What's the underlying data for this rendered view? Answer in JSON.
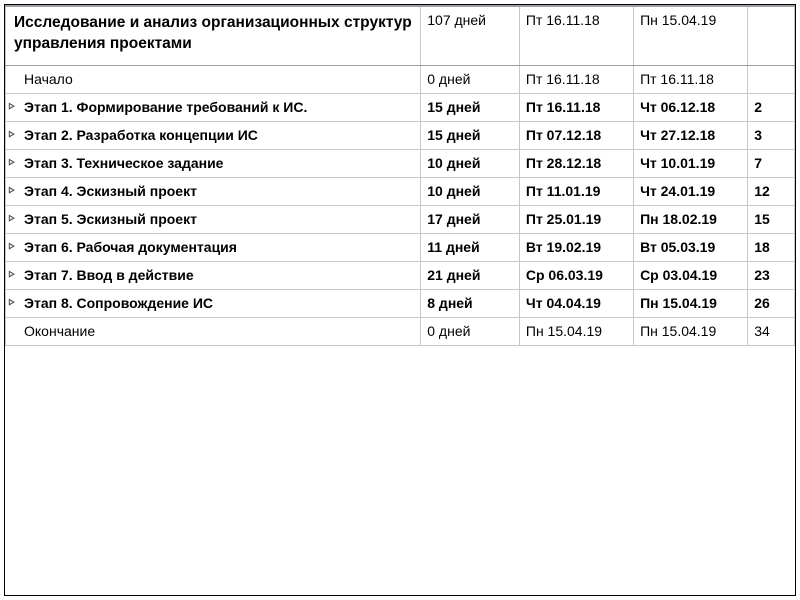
{
  "header": {
    "name": "Исследование и анализ организационных структур управления проектами",
    "duration": "107 дней",
    "start": "Пт 16.11.18",
    "end": "Пн 15.04.19",
    "num": ""
  },
  "rows": [
    {
      "bold": false,
      "expandable": false,
      "name": "Начало",
      "duration": "0 дней",
      "start": "Пт 16.11.18",
      "end": "Пт 16.11.18",
      "num": ""
    },
    {
      "bold": true,
      "expandable": true,
      "name": "Этап 1. Формирование требований к ИС.",
      "duration": "15 дней",
      "start": "Пт 16.11.18",
      "end": "Чт 06.12.18",
      "num": "2"
    },
    {
      "bold": true,
      "expandable": true,
      "name": "Этап 2. Разработка концепции ИС",
      "duration": "15 дней",
      "start": "Пт 07.12.18",
      "end": "Чт 27.12.18",
      "num": "3"
    },
    {
      "bold": true,
      "expandable": true,
      "name": "Этап 3. Техническое задание",
      "duration": "10 дней",
      "start": "Пт 28.12.18",
      "end": "Чт 10.01.19",
      "num": "7"
    },
    {
      "bold": true,
      "expandable": true,
      "name": "Этап 4. Эскизный проект",
      "duration": "10 дней",
      "start": "Пт 11.01.19",
      "end": "Чт 24.01.19",
      "num": "12"
    },
    {
      "bold": true,
      "expandable": true,
      "name": "Этап 5. Эскизный проект",
      "duration": "17 дней",
      "start": "Пт 25.01.19",
      "end": "Пн 18.02.19",
      "num": "15"
    },
    {
      "bold": true,
      "expandable": true,
      "name": "Этап 6. Рабочая документация",
      "duration": "11 дней",
      "start": "Вт 19.02.19",
      "end": "Вт 05.03.19",
      "num": "18"
    },
    {
      "bold": true,
      "expandable": true,
      "name": "Этап 7. Ввод в действие",
      "duration": "21 дней",
      "start": "Ср 06.03.19",
      "end": "Ср 03.04.19",
      "num": "23"
    },
    {
      "bold": true,
      "expandable": true,
      "name": "Этап 8. Сопровождение ИС",
      "duration": "8 дней",
      "start": "Чт 04.04.19",
      "end": "Пн 15.04.19",
      "num": "26"
    },
    {
      "bold": false,
      "expandable": false,
      "name": "Окончание",
      "duration": "0 дней",
      "start": "Пн 15.04.19",
      "end": "Пн 15.04.19",
      "num": "34"
    }
  ]
}
